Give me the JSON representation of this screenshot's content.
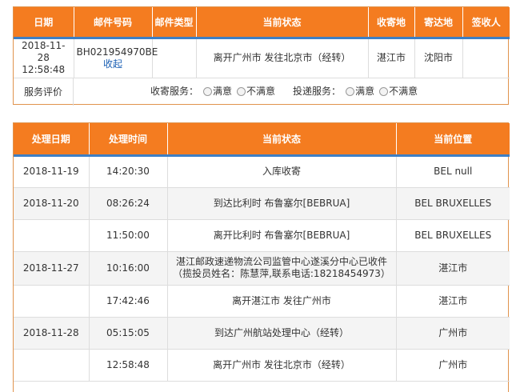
{
  "mail_table": {
    "headers": [
      "日期",
      "邮件号码",
      "邮件类型",
      "当前状态",
      "收寄地",
      "寄达地",
      "签收人"
    ],
    "row": {
      "date_line1": "2018-11-",
      "date_line2": "28 12:58:48",
      "mail_number": "BH021954970BE",
      "collapse_link": "收起",
      "mail_type": "",
      "status": "离开广州市 发往北京市（经转）",
      "origin": "湛江市",
      "destination": "沈阳市",
      "signer": ""
    },
    "evaluation": {
      "label": "服务评价",
      "collect_label": "收寄服务：",
      "delivery_label": "投递服务：",
      "satisfied": "满意",
      "unsatisfied": "不满意"
    }
  },
  "track_table": {
    "headers": [
      "处理日期",
      "处理时间",
      "当前状态",
      "当前位置"
    ],
    "rows": [
      {
        "date": "2018-11-19",
        "time": "14:20:30",
        "status": "入库收寄",
        "status2": "",
        "location": "BEL null"
      },
      {
        "date": "2018-11-20",
        "time": "08:26:24",
        "status": "到达比利时 布鲁塞尔[BEBRUA]",
        "status2": "",
        "location": "BEL BRUXELLES"
      },
      {
        "date": "",
        "time": "11:50:00",
        "status": "离开比利时 布鲁塞尔[BEBRUA]",
        "status2": "",
        "location": "BEL BRUXELLES"
      },
      {
        "date": "2018-11-27",
        "time": "10:16:00",
        "status": "湛江邮政速递物流公司监管中心遂溪分中心已收件",
        "status2": "（揽投员姓名：陈慧萍,联系电话:18218454973）",
        "location": "湛江市"
      },
      {
        "date": "",
        "time": "17:42:46",
        "status": "离开湛江市 发往广州市",
        "status2": "",
        "location": "湛江市"
      },
      {
        "date": "2018-11-28",
        "time": "05:15:05",
        "status": "到达广州航站处理中心（经转）",
        "status2": "",
        "location": "广州市"
      },
      {
        "date": "",
        "time": "12:58:48",
        "status": "离开广州市 发往北京市（经转）",
        "status2": "",
        "location": "广州市"
      }
    ]
  },
  "colors": {
    "header_bg": "#f47c20",
    "header_underline": "#3e7fc4",
    "panel_border": "#e0934d",
    "link": "#1a5fb4"
  }
}
